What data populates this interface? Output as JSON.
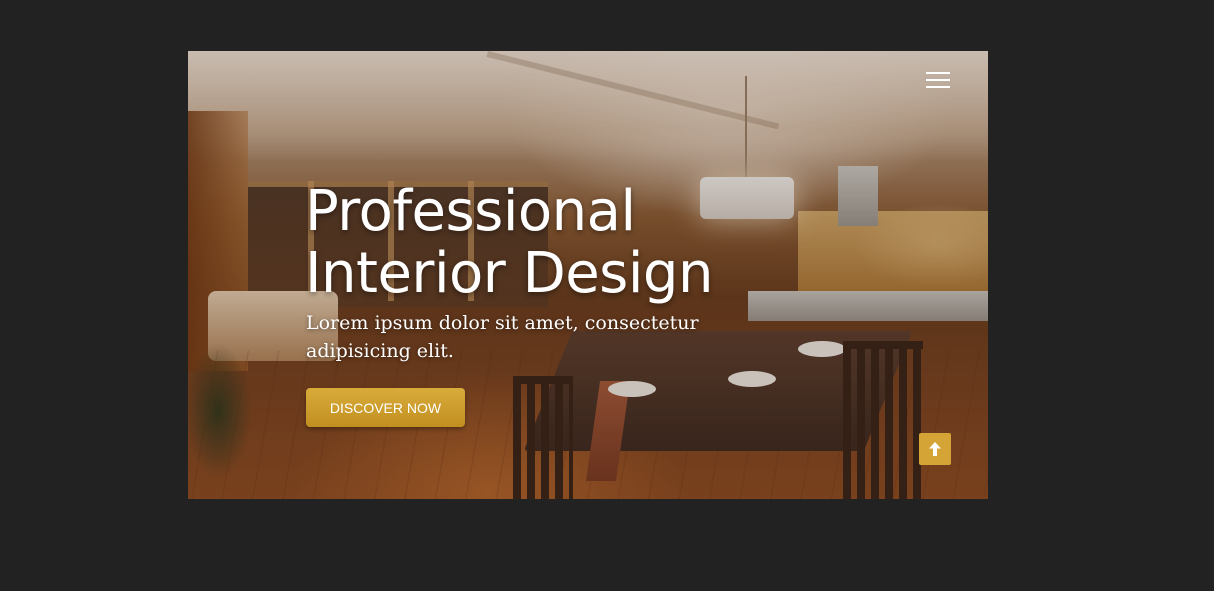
{
  "hero": {
    "title_line1": "Professional",
    "title_line2": "Interior Design",
    "subtitle": "Lorem ipsum dolor sit amet, consectetur adipisicing elit.",
    "cta_label": "Discover now"
  },
  "navigation": {
    "menu_icon": "hamburger-menu-icon"
  },
  "scroll_top": {
    "icon": "arrow-up-icon"
  },
  "colors": {
    "page_background": "#222222",
    "accent": "#d4a437",
    "text": "#ffffff"
  }
}
